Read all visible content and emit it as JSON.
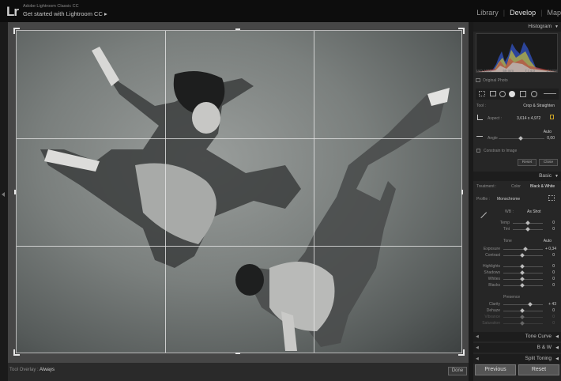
{
  "app": {
    "logo": "Lr",
    "name": "Adobe Lightroom Classic CC",
    "identity": "Get started with Lightroom CC",
    "identity_arrow": "▸"
  },
  "modules": {
    "library": "Library",
    "develop": "Develop",
    "map": "Map",
    "separator": "|"
  },
  "toolbar": {
    "overlay_label": "Tool Overlay :",
    "overlay_value": "Always",
    "done": "Done"
  },
  "histogram": {
    "title": "Histogram",
    "iso": "ISO 1000",
    "focal": "59 mm",
    "aperture": "ƒ / 4.0",
    "shutter": "1/1000",
    "original_photo": "Original Photo"
  },
  "crop": {
    "tool_label": "Tool :",
    "tool_value": "Crop & Straighten",
    "aspect_label": "Aspect :",
    "aspect_value": "3,614 x 4,972",
    "auto": "Auto",
    "angle_label": "Angle",
    "angle_value": "0,00",
    "constrain": "Constrain to Image",
    "reset": "Reset",
    "close": "Close"
  },
  "basic": {
    "title": "Basic",
    "treatment_label": "Treatment :",
    "treatment_color": "Color",
    "treatment_bw": "Black & White",
    "profile_label": "Profile :",
    "profile_value": "Monochrome",
    "wb_label": "WB :",
    "wb_value": "As Shot",
    "temp_label": "Temp",
    "temp_value": "0",
    "tint_label": "Tint",
    "tint_value": "0",
    "tone_label": "Tone",
    "tone_auto": "Auto",
    "exposure_label": "Exposure",
    "exposure_value": "+ 0,34",
    "contrast_label": "Contrast",
    "contrast_value": "0",
    "highlights_label": "Highlights",
    "highlights_value": "0",
    "shadows_label": "Shadows",
    "shadows_value": "0",
    "whites_label": "Whites",
    "whites_value": "0",
    "blacks_label": "Blacks",
    "blacks_value": "0",
    "presence_label": "Presence",
    "clarity_label": "Clarity",
    "clarity_value": "+ 43",
    "dehaze_label": "Dehaze",
    "dehaze_value": "0",
    "vibrance_label": "Vibrance",
    "vibrance_value": "0",
    "saturation_label": "Saturation",
    "saturation_value": "0"
  },
  "panels": {
    "tone_curve": "Tone Curve",
    "bw": "B & W",
    "split_toning": "Split Toning"
  },
  "bottom": {
    "previous": "Previous",
    "reset": "Reset"
  },
  "colors": {
    "accent": "#e6e6e6",
    "panel": "#262626",
    "canvas": "#464646"
  }
}
